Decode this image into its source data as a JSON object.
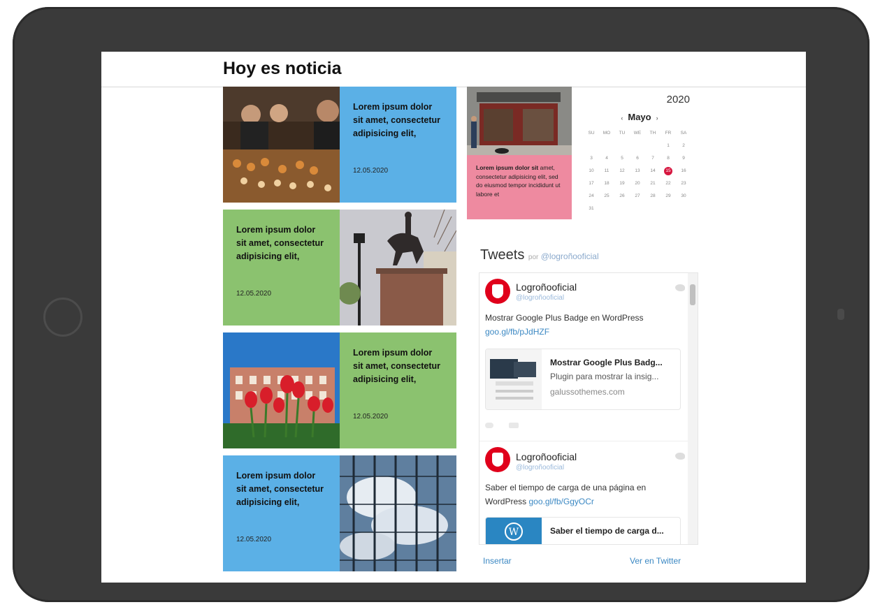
{
  "page": {
    "title": "Hoy es noticia"
  },
  "cards": [
    {
      "title": "Lorem ipsum dolor sit amet, consectetur adipisicing elit,",
      "date": "12.05.2020",
      "color": "#5bb0e6"
    },
    {
      "title": "Lorem ipsum dolor sit amet, consectetur adipisicing elit,",
      "date": "12.05.2020",
      "color": "#8bc26f"
    },
    {
      "title": "Lorem ipsum dolor sit amet, consectetur adipisicing elit,",
      "date": "12.05.2020",
      "color": "#8bc26f"
    },
    {
      "title": "Lorem ipsum dolor sit amet, consectetur adipisicing elit,",
      "date": "12.05.2020",
      "color": "#5bb0e6"
    }
  ],
  "featured": {
    "text_bold": "Lorem ipsum dolor sit",
    "text_rest": "amet, consectetur adipisicing elit, sed do eiusmod tempor incididunt ut labore et",
    "color": "#ee8aa0"
  },
  "calendar": {
    "year": "2020",
    "month": "Mayo",
    "prev": "‹",
    "next": "›",
    "weekdays": [
      "SU",
      "MO",
      "TU",
      "WE",
      "TH",
      "FR",
      "SA"
    ],
    "days": [
      "",
      "",
      "",
      "",
      "",
      "1",
      "2",
      "3",
      "4",
      "5",
      "6",
      "7",
      "8",
      "9",
      "10",
      "11",
      "12",
      "13",
      "14",
      "15",
      "16",
      "17",
      "18",
      "19",
      "20",
      "21",
      "22",
      "23",
      "24",
      "25",
      "26",
      "27",
      "28",
      "29",
      "30",
      "31"
    ],
    "selected": "15",
    "accent": "#d6163f"
  },
  "twitter": {
    "heading": "Tweets",
    "by": "por",
    "handle": "@logroñooficial",
    "tweets": [
      {
        "name": "Logroñooficial",
        "handle": "@logroñooficial",
        "text": "Mostrar Google Plus Badge en WordPress",
        "link": "goo.gl/fb/pJdHZF",
        "card": {
          "title": "Mostrar Google Plus Badg...",
          "desc": "Plugin para mostrar la insig...",
          "domain": "galussothemes.com"
        }
      },
      {
        "name": "Logroñooficial",
        "handle": "@logroñooficial",
        "text": "Saber el tiempo de carga de una página en WordPress",
        "link": "goo.gl/fb/GgyOCr",
        "card": {
          "title": "Saber el tiempo de carga d..."
        }
      }
    ],
    "footer": {
      "embed": "Insertar",
      "view": "Ver en Twitter"
    }
  }
}
